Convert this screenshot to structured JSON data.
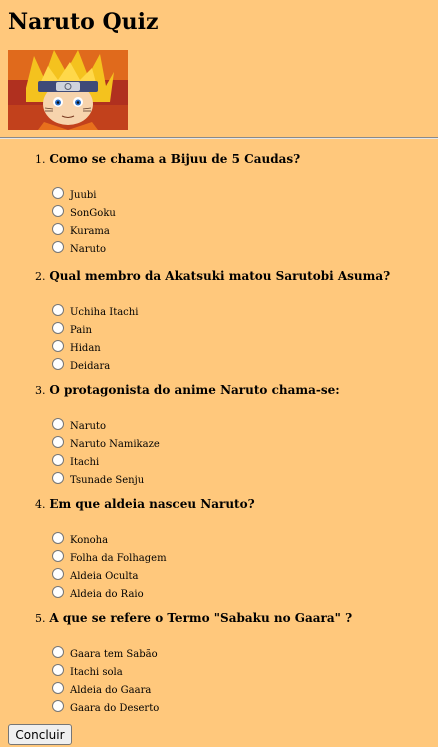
{
  "page": {
    "title": "Naruto Quiz",
    "image_icon": "naruto-character-image"
  },
  "questions": [
    {
      "number": "1.",
      "text": "Como se chama a Bijuu de 5 Caudas?",
      "options": [
        "Juubi",
        "SonGoku",
        "Kurama",
        "Naruto"
      ]
    },
    {
      "number": "2.",
      "text": "Qual membro da Akatsuki matou Sarutobi Asuma?",
      "options": [
        "Uchiha Itachi",
        "Pain",
        "Hidan",
        "Deidara"
      ]
    },
    {
      "number": "3.",
      "text": "O protagonista do anime Naruto chama-se:",
      "options": [
        "Naruto",
        "Naruto Namikaze",
        "Itachi",
        "Tsunade Senju"
      ]
    },
    {
      "number": "4.",
      "text": "Em que aldeia nasceu Naruto?",
      "options": [
        "Konoha",
        "Folha da Folhagem",
        "Aldeia Oculta",
        "Aldeia do Raio"
      ]
    },
    {
      "number": "5.",
      "text": "A que se refere o Termo \"Sabaku no Gaara\" ?",
      "options": [
        "Gaara tem Sabão",
        "Itachi sola",
        "Aldeia do Gaara",
        "Gaara do Deserto"
      ]
    }
  ],
  "form": {
    "submit_label": "Concluir"
  },
  "colors": {
    "background": "#ffc87c",
    "radio_border": "#767676",
    "button_background": "#efefef"
  }
}
